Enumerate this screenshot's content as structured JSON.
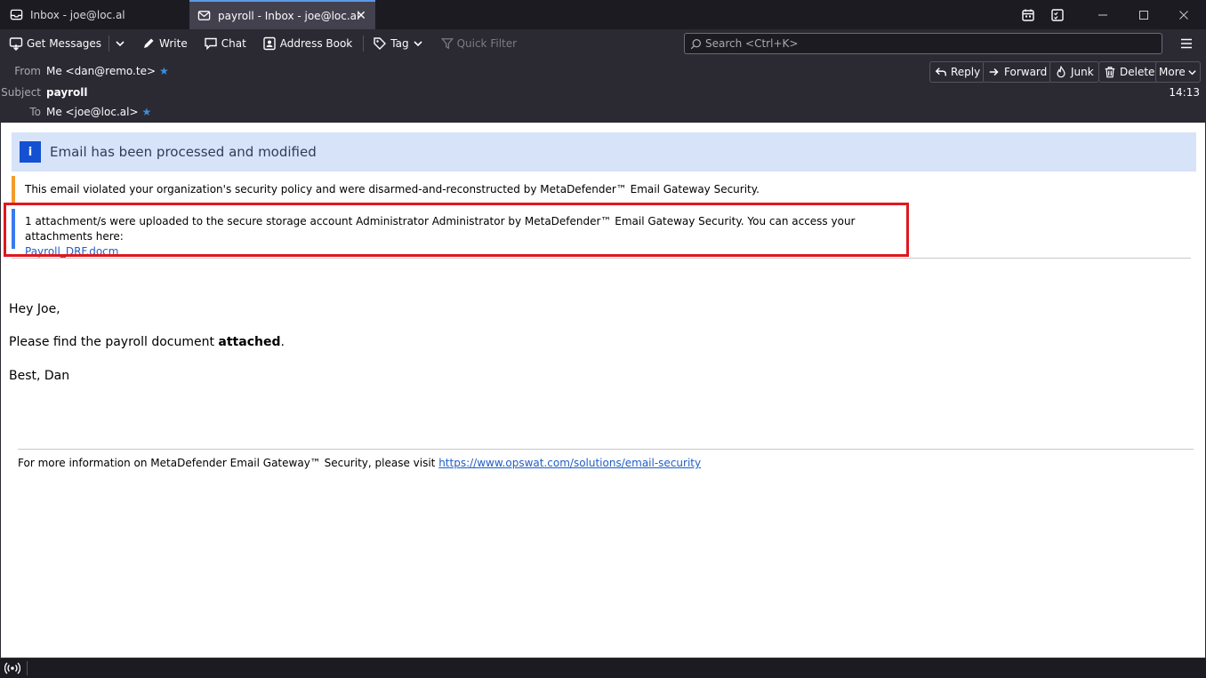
{
  "tabs": [
    {
      "label": "Inbox - joe@loc.al"
    },
    {
      "label": "payroll - Inbox - joe@loc.al"
    }
  ],
  "toolbar": {
    "get_messages": "Get Messages",
    "write": "Write",
    "chat": "Chat",
    "address_book": "Address Book",
    "tag": "Tag",
    "quick_filter": "Quick Filter",
    "search_placeholder": "Search <Ctrl+K>"
  },
  "header": {
    "from_label": "From",
    "from_value": "Me <dan@remo.te>",
    "subject_label": "Subject",
    "subject_value": "payroll",
    "to_label": "To",
    "to_value": "Me <joe@loc.al>",
    "time": "14:13",
    "reply": "Reply",
    "forward": "Forward",
    "junk": "Junk",
    "delete": "Delete",
    "more": "More"
  },
  "banner": {
    "text": "Email has been processed and modified",
    "icon": "i",
    "color": "#1450d2"
  },
  "notices": {
    "policy": "This email violated your organization's security policy and were disarmed-and-reconstructed by MetaDefender™ Email Gateway Security.",
    "upload": "1 attachment/s were uploaded to the secure storage account Administrator Administrator by MetaDefender™ Email Gateway Security. You can access your attachments here:",
    "attachment_link": "Payroll_DRF.docm",
    "policy_color": "#f39c2c",
    "upload_color": "#3a7bed"
  },
  "message": {
    "greeting": "Hey Joe,",
    "line_prefix": "Please find the payroll document ",
    "line_bold": "attached",
    "line_suffix": ".",
    "signoff": "Best, Dan"
  },
  "footer": {
    "text": "For more information on MetaDefender Email Gateway™ Security, please visit ",
    "link": "https://www.opswat.com/solutions/email-security"
  }
}
